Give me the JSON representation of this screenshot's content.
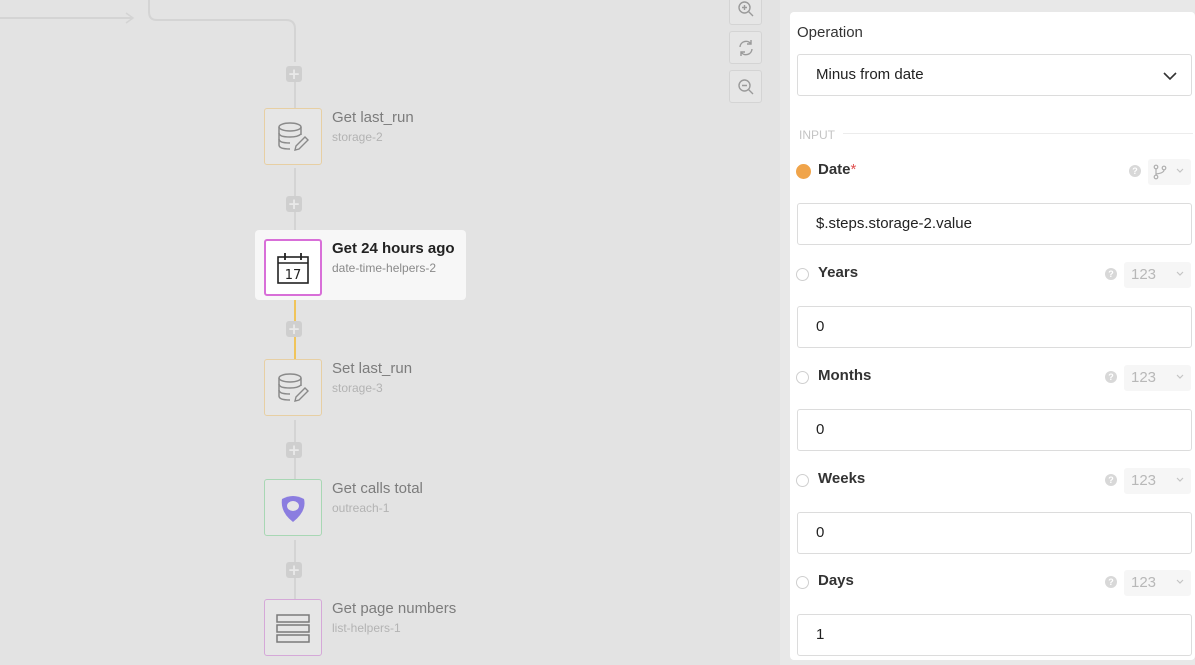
{
  "canvas": {
    "nodes": [
      {
        "title": "Get last_run",
        "subtitle": "storage-2",
        "icon": "database-edit-icon",
        "border_color": "#e7cfa3"
      },
      {
        "title": "Get 24 hours ago",
        "subtitle": "date-time-helpers-2",
        "icon": "calendar-icon",
        "calendar_day": "17",
        "selected": true,
        "border_color": "#d86fd8"
      },
      {
        "title": "Set last_run",
        "subtitle": "storage-3",
        "icon": "database-edit-icon",
        "border_color": "#e7cfa3"
      },
      {
        "title": "Get calls total",
        "subtitle": "outreach-1",
        "icon": "outreach-logo-icon",
        "border_color": "#a8d7b4"
      },
      {
        "title": "Get page numbers",
        "subtitle": "list-helpers-1",
        "icon": "list-icon",
        "border_color": "#d5a8d8"
      }
    ],
    "add_step_symbol": "+",
    "zoom_controls": [
      "zoom-in-icon",
      "reset-icon",
      "zoom-out-icon"
    ]
  },
  "panel": {
    "operation_label": "Operation",
    "operation_value": "Minus from date",
    "section_label": "INPUT",
    "fields": [
      {
        "label": "Date",
        "required_mark": "*",
        "value": "$.steps.storage-2.value",
        "type_icon": "branch-icon",
        "filled": true
      },
      {
        "label": "Years",
        "value": "0",
        "type_label": "123"
      },
      {
        "label": "Months",
        "value": "0",
        "type_label": "123"
      },
      {
        "label": "Weeks",
        "value": "0",
        "type_label": "123"
      },
      {
        "label": "Days",
        "value": "1",
        "type_label": "123"
      }
    ],
    "help_symbol": "?"
  },
  "colors": {
    "accent_selected": "#d86fd8",
    "storage": "#e7cfa3",
    "required_dot": "#f0a44a",
    "outreach": "#8b7de0"
  }
}
